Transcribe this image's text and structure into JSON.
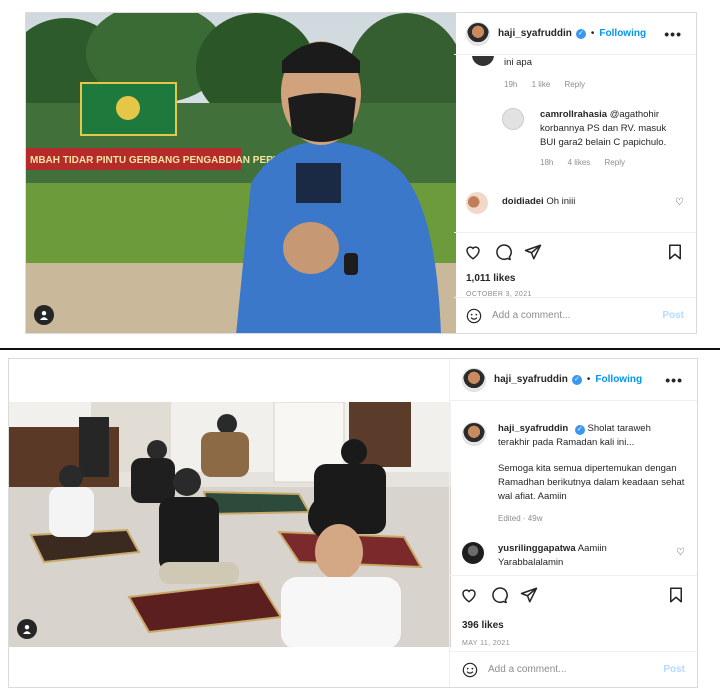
{
  "post1": {
    "header": {
      "username": "haji_syafruddin",
      "follow_label": "Following",
      "more_label": "•••"
    },
    "banner_text": "MBAH TIDAR PINTU GERBANG PENGABDIAN PERWIRA",
    "comments": [
      {
        "username": "",
        "text": "ini apa",
        "time": "19h",
        "likes": "1 like",
        "reply": "Reply"
      },
      {
        "username": "camrollrahasia",
        "text": "@agathohir korbannya PS dan RV. masuk BUI gara2 belain C papichulo.",
        "time": "18h",
        "likes": "4 likes",
        "reply": "Reply"
      },
      {
        "username": "doidiadei",
        "text": "Oh iniii"
      }
    ],
    "likes": "1,011 likes",
    "date": "OCTOBER 3, 2021",
    "add_comment_placeholder": "Add a comment...",
    "post_label": "Post"
  },
  "post2": {
    "header": {
      "username": "haji_syafruddin",
      "follow_label": "Following",
      "more_label": "•••"
    },
    "caption": {
      "username": "haji_syafruddin",
      "line1": "Sholat taraweh terakhir pada Ramadan kali ini...",
      "line2": "Semoga kita semua dipertemukan dengan Ramadhan berikutnya dalam keadaan sehat wal afiat. Aamiin",
      "meta": "Edited · 49w"
    },
    "comments": [
      {
        "username": "yusrilinggapatwa",
        "text": "Aamiin Yarabbalalamin"
      }
    ],
    "likes": "396 likes",
    "date": "MAY 11, 2021",
    "add_comment_placeholder": "Add a comment...",
    "post_label": "Post"
  },
  "colors": {
    "link": "#0095f6",
    "muted": "#8e8e8e",
    "border": "#dbdbdb"
  },
  "icons": [
    "heart-icon",
    "comment-icon",
    "share-icon",
    "bookmark-icon",
    "emoji-icon",
    "user-tag-icon",
    "verified-badge-icon"
  ]
}
